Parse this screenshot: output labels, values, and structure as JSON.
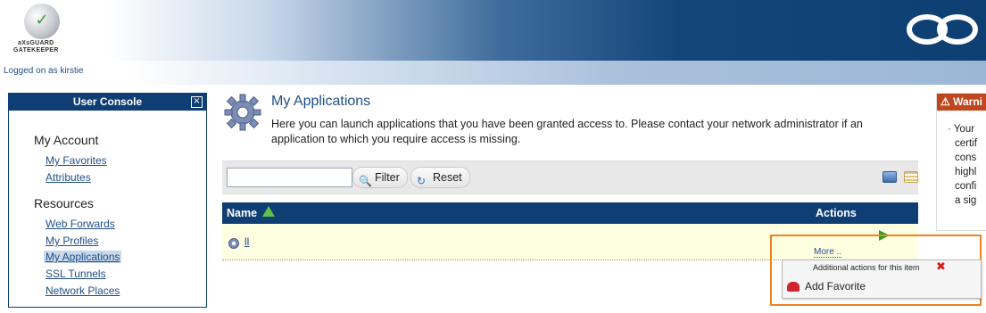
{
  "header": {
    "brand_line1": "aXsGUARD",
    "brand_line2": "GATEKEEPER",
    "logged_on": "Logged on as kirstie"
  },
  "sidebar": {
    "title": "User Console",
    "close_icon": "close-icon",
    "sections": [
      {
        "label": "My Account",
        "items": [
          {
            "label": "My Favorites"
          },
          {
            "label": "Attributes"
          }
        ]
      },
      {
        "label": "Resources",
        "items": [
          {
            "label": "Web Forwards"
          },
          {
            "label": "My Profiles"
          },
          {
            "label": "My Applications",
            "active": true
          },
          {
            "label": "SSL Tunnels"
          },
          {
            "label": "Network Places"
          }
        ]
      }
    ]
  },
  "main": {
    "title": "My Applications",
    "description": "Here you can launch applications that you have been granted access to. Please contact your network administrator if an application to which you require access is missing.",
    "filter": {
      "value": "",
      "filter_label": "Filter",
      "reset_label": "Reset"
    },
    "grid": {
      "columns": [
        "Name",
        "Actions"
      ],
      "rows": [
        {
          "name": "ll",
          "more_label": "More .."
        }
      ]
    },
    "popup": {
      "header": "Additional actions for this item",
      "items": [
        {
          "label": "Add Favorite"
        }
      ]
    }
  },
  "warning": {
    "title": "Warni",
    "lines": [
      "· Your",
      "certif",
      "cons",
      "highl",
      "confi",
      "a sig"
    ]
  },
  "colors": {
    "navy": "#0f3e74",
    "link": "#1f4f88",
    "row_highlight": "#fefee0",
    "popup_highlight": "#f0821e",
    "warning": "#c0461e"
  }
}
